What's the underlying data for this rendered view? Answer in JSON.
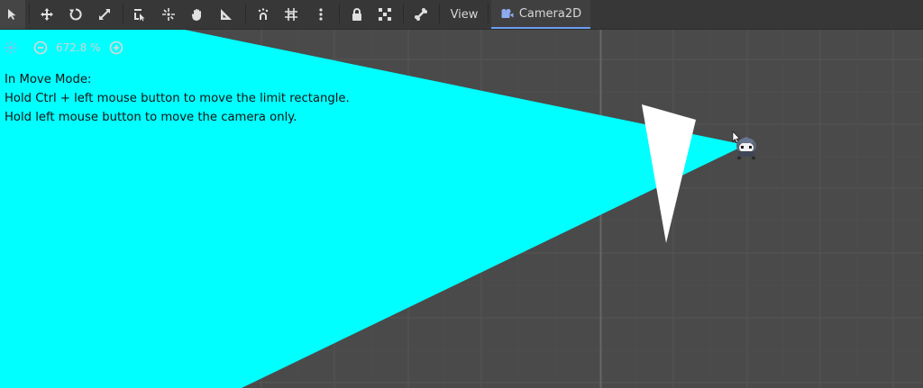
{
  "toolbar": {
    "tools": [
      {
        "icon": "select-arrow-icon"
      },
      {
        "icon": "move-icon"
      },
      {
        "icon": "rotate-icon"
      },
      {
        "icon": "scale-icon"
      },
      {
        "icon": "list-select-icon"
      },
      {
        "icon": "pivot-icon"
      },
      {
        "icon": "pan-hand-icon"
      },
      {
        "icon": "ruler-icon"
      },
      {
        "icon": "smart-snap-icon"
      },
      {
        "icon": "grid-snap-icon"
      },
      {
        "icon": "more-vertical-icon"
      },
      {
        "icon": "lock-icon"
      },
      {
        "icon": "group-icon"
      },
      {
        "icon": "bone-icon"
      }
    ],
    "view_menu": "View",
    "active_tab": {
      "label": "Camera2D",
      "icon": "camera-icon"
    }
  },
  "zoom": {
    "center_icon": "center-view-icon",
    "zoom_out_icon": "zoom-out-icon",
    "level": "672.8 %",
    "zoom_in_icon": "zoom-in-icon"
  },
  "hint": {
    "line1": "In Move Mode:",
    "line2": "Hold Ctrl + left mouse button to move the limit rectangle.",
    "line3": "Hold left mouse button to move the camera only."
  },
  "colors": {
    "viewport_bg": "#4a4a4a",
    "grid": "#555555",
    "axis": "#666666",
    "limit_shape": "#00ffff",
    "triangle": "#ffffff",
    "accent": "#6a9ef0"
  }
}
